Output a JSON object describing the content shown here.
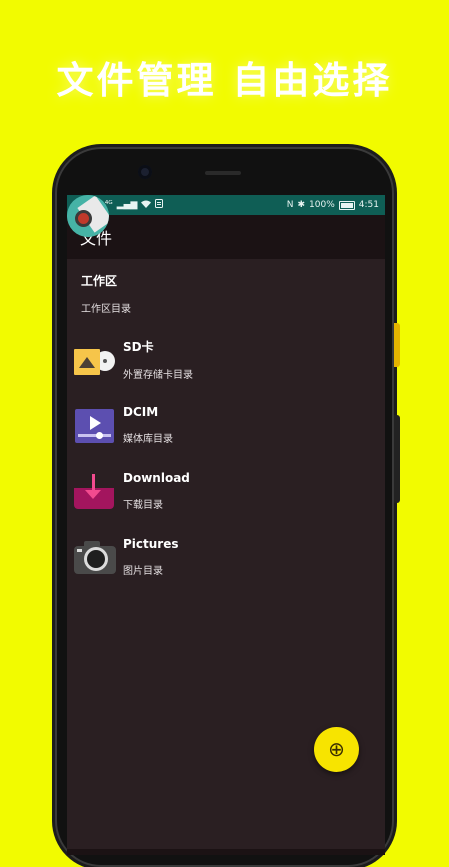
{
  "headline": "文件管理 自由选择",
  "colors": {
    "background": "#f2fb00",
    "status_bar": "#0f5e55",
    "app_bar": "#1b1214",
    "list_bg": "#2a1f22",
    "fab": "#f7e400"
  },
  "status_bar": {
    "left_icons": [
      "HD",
      "⁴ᴳ",
      "▂▄▆",
      "wifi-icon",
      "notification-icon"
    ],
    "nfc": "N",
    "bluetooth": "✱",
    "battery_text": "100%",
    "time": "4:51"
  },
  "app_bar": {
    "title": "文件"
  },
  "items": [
    {
      "icon": "workspace-icon",
      "title": "工作区",
      "subtitle": "工作区目录"
    },
    {
      "icon": "sd-card-icon",
      "title": "SD卡",
      "subtitle": "外置存储卡目录"
    },
    {
      "icon": "media-icon",
      "title": "DCIM",
      "subtitle": "媒体库目录"
    },
    {
      "icon": "download-icon",
      "title": "Download",
      "subtitle": "下载目录"
    },
    {
      "icon": "camera-icon",
      "title": "Pictures",
      "subtitle": "图片目录"
    }
  ],
  "fab": {
    "icon": "add-icon",
    "glyph": "⊕"
  }
}
